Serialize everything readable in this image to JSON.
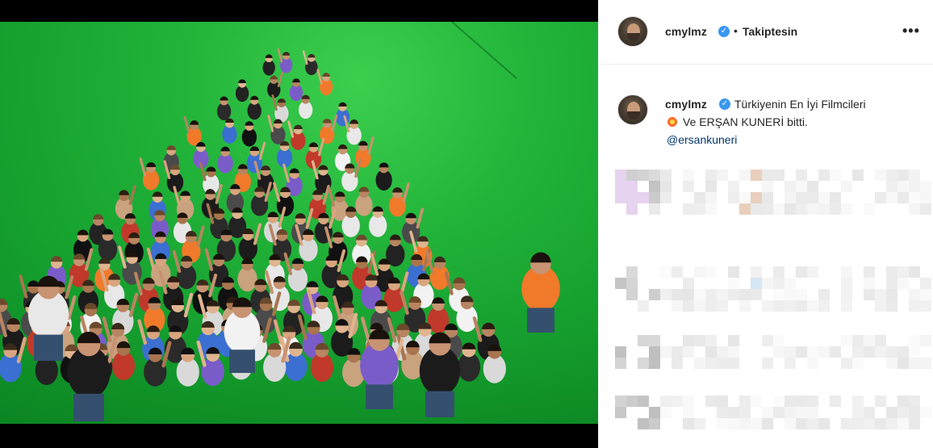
{
  "post": {
    "username": "cmylmz",
    "verified_glyph": "✓",
    "separator": "•",
    "follow_state": "Takiptesin",
    "more_glyph": "•••",
    "photo_description_icon": "group-photo-green-screen"
  },
  "caption": {
    "username": "cmylmz",
    "text_line1": "Türkiyenin En İyi Filmcileri",
    "text_line2": "Ve ERŞAN KUNERİ bitti.",
    "emoji_icon": "collision-icon",
    "mention": "@ersankuneri"
  },
  "colors": {
    "verified": "#3897f0",
    "mention": "#00376b",
    "green_screen": "#22b43a"
  }
}
